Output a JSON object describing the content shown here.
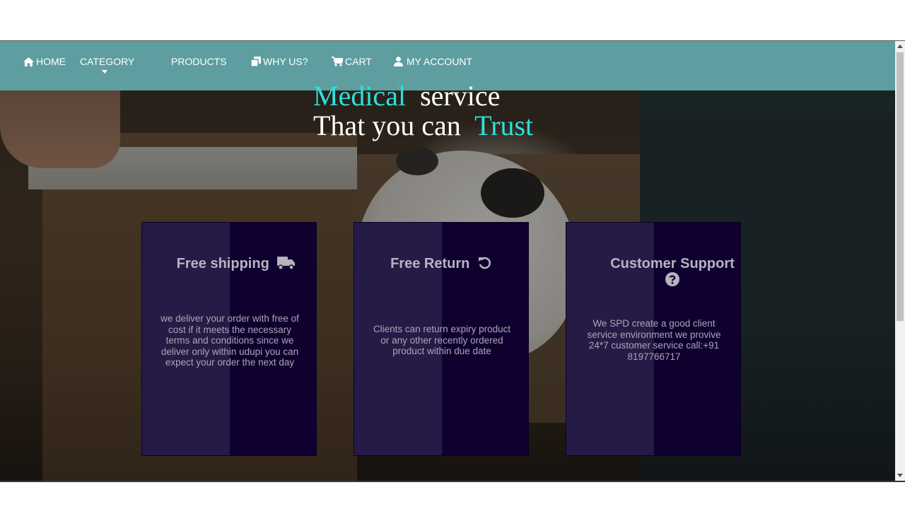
{
  "nav": {
    "home": "HOME",
    "category": "CATEGORY",
    "products": "PRODUCTS",
    "why_us": "WHY US?",
    "cart": "CART",
    "my_account": "MY ACCOUNT"
  },
  "headline": {
    "word1": "Medical",
    "word2": "service",
    "line2_text": "That you can",
    "word3": "Trust"
  },
  "cards": [
    {
      "title": "Free shipping",
      "icon": "truck-icon",
      "body": "we deliver your order with free of cost if it meets the necessary terms and conditions since we deliver only within udupi you can expect your order the next day"
    },
    {
      "title": "Free Return",
      "icon": "undo-icon",
      "body": "Clients can return expiry product or any other recently ordered product within due date"
    },
    {
      "title": "Customer Support",
      "icon": "question-circle-icon",
      "body": "We SPD create a good client service environment we provive 24*7 customer service call:+91 8197766717"
    }
  ],
  "colors": {
    "navbar": "#5e9ea0",
    "accent": "#2de0dc",
    "card_left": "#261b47",
    "card_right": "#0f0030"
  }
}
